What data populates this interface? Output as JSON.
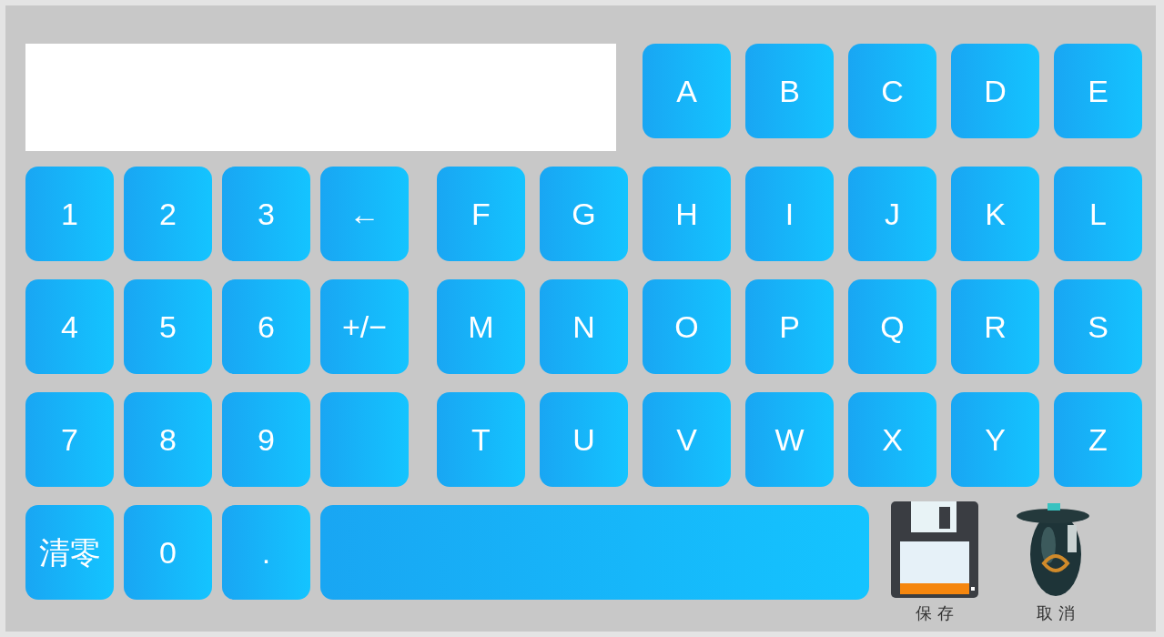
{
  "top_keys": [
    {
      "label": "A"
    },
    {
      "label": "B"
    },
    {
      "label": "C"
    },
    {
      "label": "D"
    },
    {
      "label": "E"
    }
  ],
  "rows": [
    {
      "left": [
        {
          "kind": "char",
          "label": "1"
        },
        {
          "kind": "char",
          "label": "2"
        },
        {
          "kind": "char",
          "label": "3"
        },
        {
          "kind": "char",
          "label": "←"
        }
      ],
      "right": [
        {
          "kind": "char",
          "label": "F"
        },
        {
          "kind": "char",
          "label": "G"
        },
        {
          "kind": "char",
          "label": "H"
        },
        {
          "kind": "char",
          "label": "I"
        },
        {
          "kind": "char",
          "label": "J"
        },
        {
          "kind": "char",
          "label": "K"
        },
        {
          "kind": "char",
          "label": "L"
        }
      ]
    },
    {
      "left": [
        {
          "kind": "char",
          "label": "4"
        },
        {
          "kind": "char",
          "label": "5"
        },
        {
          "kind": "char",
          "label": "6"
        },
        {
          "kind": "char",
          "label": "+/−"
        }
      ],
      "right": [
        {
          "kind": "char",
          "label": "M"
        },
        {
          "kind": "char",
          "label": "N"
        },
        {
          "kind": "char",
          "label": "O"
        },
        {
          "kind": "char",
          "label": "P"
        },
        {
          "kind": "char",
          "label": "Q"
        },
        {
          "kind": "char",
          "label": "R"
        },
        {
          "kind": "char",
          "label": "S"
        }
      ]
    },
    {
      "left": [
        {
          "kind": "char",
          "label": "7"
        },
        {
          "kind": "char",
          "label": "8"
        },
        {
          "kind": "char",
          "label": "9"
        },
        {
          "kind": "blank"
        }
      ],
      "right": [
        {
          "kind": "char",
          "label": "T"
        },
        {
          "kind": "char",
          "label": "U"
        },
        {
          "kind": "char",
          "label": "V"
        },
        {
          "kind": "char",
          "label": "W"
        },
        {
          "kind": "char",
          "label": "X"
        },
        {
          "kind": "char",
          "label": "Y"
        },
        {
          "kind": "char",
          "label": "Z"
        }
      ]
    }
  ],
  "bottom_keys": [
    {
      "kind": "char",
      "label": "清零"
    },
    {
      "kind": "char",
      "label": "0"
    },
    {
      "kind": "char",
      "label": "."
    },
    {
      "kind": "space"
    }
  ],
  "actions": [
    {
      "kind": "save",
      "label": "保 存"
    },
    {
      "kind": "cancel",
      "label": "取 消"
    }
  ]
}
